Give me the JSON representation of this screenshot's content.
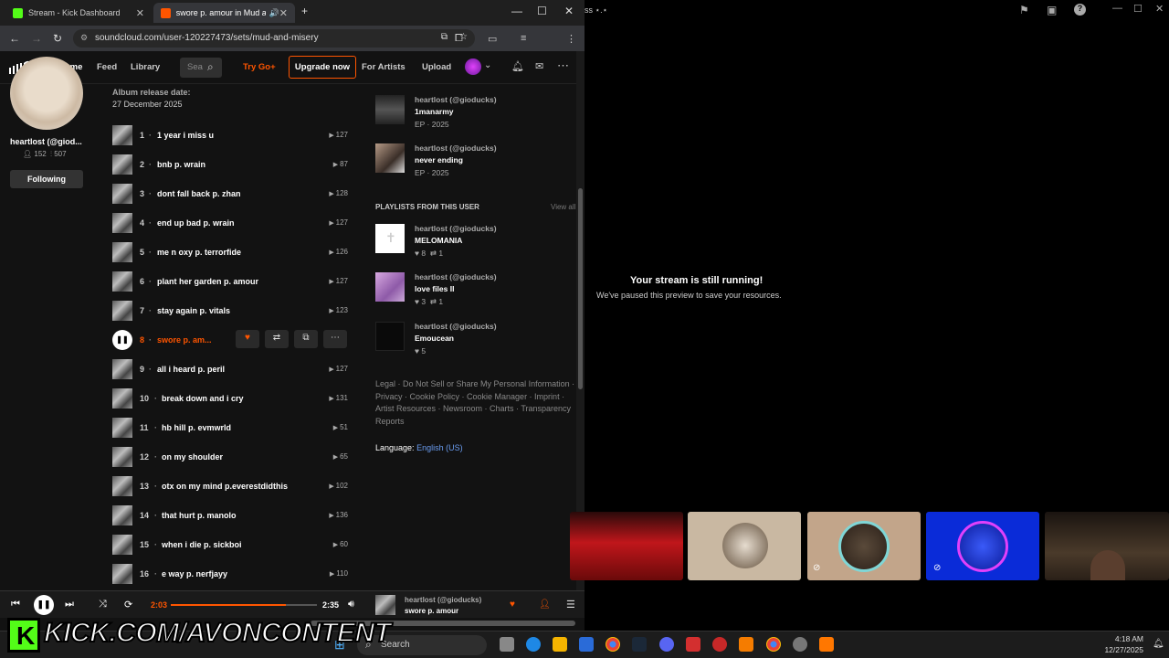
{
  "browser": {
    "tabs": [
      {
        "title": "Stream - Kick Dashboard",
        "active": false
      },
      {
        "title": "swore p. amour in Mud and",
        "active": true
      }
    ],
    "url": "soundcloud.com/user-120227473/sets/mud-and-misery"
  },
  "header": {
    "nav": [
      "Home",
      "Feed",
      "Library"
    ],
    "search_placeholder": "Sea",
    "try_go": "Try Go+",
    "upgrade": "Upgrade now",
    "for_artists": "For Artists",
    "upload": "Upload"
  },
  "profile": {
    "name": "heartlost (@giod...",
    "followers": "152",
    "tracks": "507",
    "following_button": "Following"
  },
  "album": {
    "release_label": "Album release date:",
    "release_date": "27 December 2025"
  },
  "tracks": [
    {
      "num": "1",
      "title": "1 year i miss u",
      "plays": "127"
    },
    {
      "num": "2",
      "title": "bnb p. wrain",
      "plays": "87"
    },
    {
      "num": "3",
      "title": "dont fall back p. zhan",
      "plays": "128"
    },
    {
      "num": "4",
      "title": "end up bad p. wrain",
      "plays": "127"
    },
    {
      "num": "5",
      "title": "me n oxy p. terrorfide",
      "plays": "126"
    },
    {
      "num": "6",
      "title": "plant her garden p. amour",
      "plays": "127"
    },
    {
      "num": "7",
      "title": "stay again p. vitals",
      "plays": "123"
    },
    {
      "num": "8",
      "title": "swore p. am...",
      "plays": ""
    },
    {
      "num": "9",
      "title": "all i heard p. peril",
      "plays": "127"
    },
    {
      "num": "10",
      "title": "break down and i cry",
      "plays": "131"
    },
    {
      "num": "11",
      "title": "hb hill p. evmwrld",
      "plays": "51"
    },
    {
      "num": "12",
      "title": "on my shoulder",
      "plays": "65"
    },
    {
      "num": "13",
      "title": "otx on my mind p.everestdidthis",
      "plays": "102"
    },
    {
      "num": "14",
      "title": "that hurt p. manolo",
      "plays": "136"
    },
    {
      "num": "15",
      "title": "when i die p. sickboi",
      "plays": "60"
    },
    {
      "num": "16",
      "title": "e way p. nerfjayy",
      "plays": "110"
    }
  ],
  "related": [
    {
      "artist": "heartlost (@gioducks)",
      "title": "1manarmy",
      "meta": "EP · 2025"
    },
    {
      "artist": "heartlost (@gioducks)",
      "title": "never ending",
      "meta": "EP · 2025"
    }
  ],
  "playlists_heading": "PLAYLISTS FROM THIS USER",
  "view_all": "View all",
  "playlists": [
    {
      "artist": "heartlost (@gioducks)",
      "title": "MELOMANIA",
      "likes": "8",
      "reposts": "1"
    },
    {
      "artist": "heartlost (@gioducks)",
      "title": "love files II",
      "likes": "3",
      "reposts": "1"
    },
    {
      "artist": "heartlost (@gioducks)",
      "title": "Emoucean",
      "likes": "5",
      "reposts": ""
    }
  ],
  "footer": {
    "links": "Legal · Do Not Sell or Share My Personal Information · Privacy · Cookie Policy · Cookie Manager · Imprint · Artist Resources · Newsroom · Charts · Transparency Reports",
    "language_label": "Language:",
    "language_value": "English (US)"
  },
  "player": {
    "elapsed": "2:03",
    "duration": "2:35",
    "progress": 0.79,
    "artist": "heartlost (@gioducks)",
    "title": "swore p. amour"
  },
  "stream": {
    "window_title": "ss ⋆.⋆",
    "message_title": "Your stream is still running!",
    "message_body": "We've paused this preview to save your resources."
  },
  "overlay": {
    "kick_text": "KICK.COM/AVONCONTENT"
  },
  "taskbar": {
    "search": "Search",
    "time": "4:18 AM",
    "date": "12/27/2025"
  },
  "colors": {
    "accent": "#ff5500",
    "kick_green": "#53fc18",
    "link_blue": "#6a9cf0"
  }
}
